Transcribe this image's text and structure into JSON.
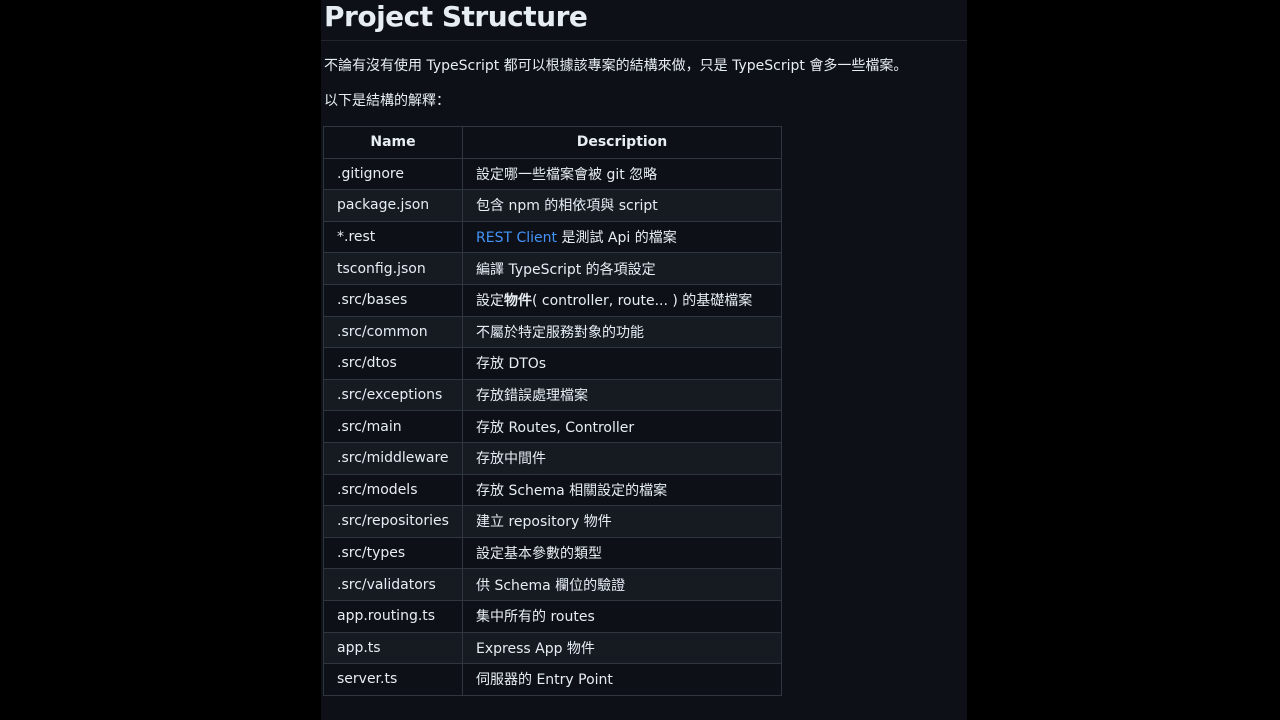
{
  "heading": "Project Structure",
  "intro": "不論有沒有使用 TypeScript 都可以根據該專案的結構來做，只是 TypeScript 會多一些檔案。",
  "explanation": "以下是結構的解釋：",
  "table": {
    "headers": [
      "Name",
      "Description"
    ],
    "rows": [
      {
        "name": ".gitignore",
        "desc": "設定哪一些檔案會被 git 忽略"
      },
      {
        "name": "package.json",
        "desc": "包含 npm 的相依項與 script"
      },
      {
        "name": "*.rest",
        "link": "REST Client",
        "desc": " 是測試 Api 的檔案"
      },
      {
        "name": "tsconfig.json",
        "desc": "編譯 TypeScript 的各項設定"
      },
      {
        "name": ".src/bases",
        "desc_pre": "設定",
        "desc_strong": "物件",
        "desc": "( controller, route... ) 的基礎檔案"
      },
      {
        "name": ".src/common",
        "desc": "不屬於特定服務對象的功能"
      },
      {
        "name": ".src/dtos",
        "desc": "存放 DTOs"
      },
      {
        "name": ".src/exceptions",
        "desc": "存放錯誤處理檔案"
      },
      {
        "name": ".src/main",
        "desc": "存放 Routes, Controller"
      },
      {
        "name": ".src/middleware",
        "desc": "存放中間件"
      },
      {
        "name": ".src/models",
        "desc": "存放 Schema 相關設定的檔案"
      },
      {
        "name": ".src/repositories",
        "desc": "建立 repository 物件"
      },
      {
        "name": ".src/types",
        "desc": "設定基本參數的類型"
      },
      {
        "name": ".src/validators",
        "desc": "供 Schema 欄位的驗證"
      },
      {
        "name": "app.routing.ts",
        "desc": "集中所有的 routes"
      },
      {
        "name": "app.ts",
        "desc": "Express App 物件"
      },
      {
        "name": "server.ts",
        "desc": "伺服器的 Entry Point"
      }
    ]
  },
  "colors": {
    "background": "#0d1117",
    "text": "#e6edf3",
    "border": "#30363d",
    "stripe": "#161b22",
    "link": "#4493f8"
  }
}
